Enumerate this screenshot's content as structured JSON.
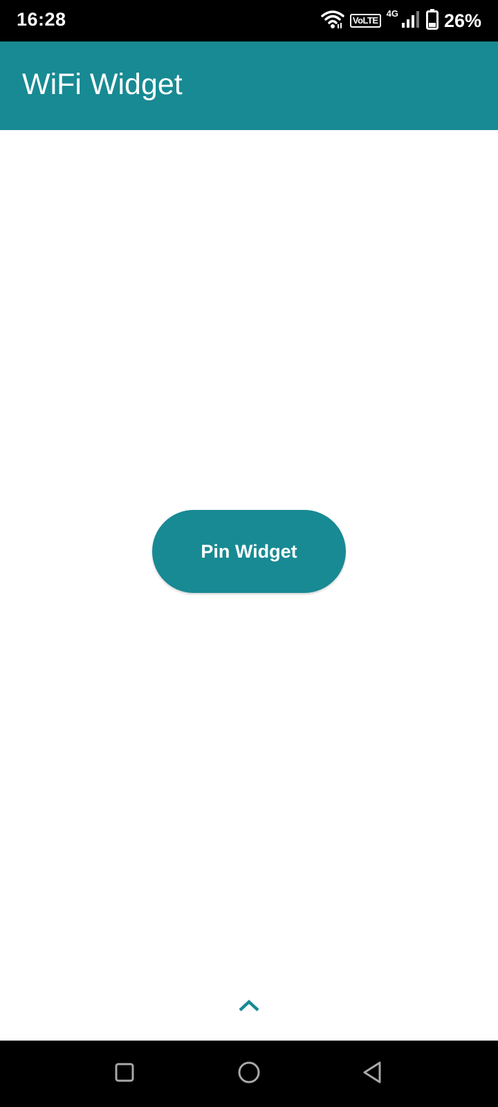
{
  "status_bar": {
    "time": "16:28",
    "volte": "VoLTE",
    "network_type": "4G",
    "battery_percent": "26%",
    "icons": [
      "wifi-icon",
      "volte-icon",
      "signal-icon",
      "battery-icon"
    ]
  },
  "app_bar": {
    "title": "WiFi Widget",
    "color": "#188a93"
  },
  "main": {
    "pin_button_label": "Pin Widget"
  },
  "bottom": {
    "expand_icon": "chevron-up-icon"
  },
  "nav_bar": {
    "icons": [
      "recents-square-icon",
      "home-circle-icon",
      "back-triangle-icon"
    ]
  }
}
